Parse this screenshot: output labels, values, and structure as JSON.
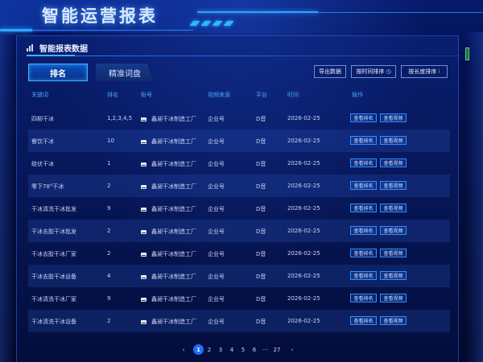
{
  "page_title": "智能运营报表",
  "panel": {
    "title": "智能报表数据"
  },
  "tabs": [
    {
      "label": "排名",
      "active": true
    },
    {
      "label": "精准词盘",
      "active": false
    }
  ],
  "toolbar": {
    "export_label": "导出数据",
    "sort_time_label": "按时间排序",
    "sort_length_label": "按长度排序"
  },
  "table": {
    "columns": [
      "关键词",
      "排名",
      "账号",
      "视频来源",
      "平台",
      "时间",
      "操作"
    ],
    "rows": [
      {
        "keyword": "四柳干冰",
        "rank": "1,2,3,4,5",
        "account": "鑫昶干冰制造工厂",
        "source": "企业号",
        "platform": "D音",
        "time": "2026-02-25"
      },
      {
        "keyword": "餐饮干冰",
        "rank": "10",
        "account": "鑫昶干冰制造工厂",
        "source": "企业号",
        "platform": "D音",
        "time": "2026-02-25"
      },
      {
        "keyword": "硅伏干冰",
        "rank": "1",
        "account": "鑫昶干冰制造工厂",
        "source": "企业号",
        "platform": "D音",
        "time": "2026-02-25"
      },
      {
        "keyword": "零下78°干冰",
        "rank": "2",
        "account": "鑫昶干冰制造工厂",
        "source": "企业号",
        "platform": "D音",
        "time": "2026-02-25"
      },
      {
        "keyword": "干冰清洗干冰批发",
        "rank": "9",
        "account": "鑫昶干冰制造工厂",
        "source": "企业号",
        "platform": "D音",
        "time": "2026-02-25"
      },
      {
        "keyword": "干冰去胶干冰批发",
        "rank": "2",
        "account": "鑫昶干冰制造工厂",
        "source": "企业号",
        "platform": "D音",
        "time": "2026-02-25"
      },
      {
        "keyword": "干冰去胶干冰厂家",
        "rank": "2",
        "account": "鑫昶干冰制造工厂",
        "source": "企业号",
        "platform": "D音",
        "time": "2026-02-25"
      },
      {
        "keyword": "干冰去胶干冰设备",
        "rank": "4",
        "account": "鑫昶干冰制造工厂",
        "source": "企业号",
        "platform": "D音",
        "time": "2026-02-25"
      },
      {
        "keyword": "干冰清洗干冰厂家",
        "rank": "9",
        "account": "鑫昶干冰制造工厂",
        "source": "企业号",
        "platform": "D音",
        "time": "2026-02-25"
      },
      {
        "keyword": "干冰清洗干冰设备",
        "rank": "2",
        "account": "鑫昶干冰制造工厂",
        "source": "企业号",
        "platform": "D音",
        "time": "2026-02-25"
      }
    ],
    "action_view_rank": "查看排名",
    "action_view_video": "查看视频"
  },
  "pagination": {
    "prev": "‹",
    "pages": [
      "1",
      "2",
      "3",
      "4",
      "5",
      "6"
    ],
    "ellipsis": "···",
    "last": "27",
    "next": "›",
    "current": "1"
  },
  "colors": {
    "background": "#030d3a",
    "accent": "#39b4ff",
    "header_text": "#4fa3ff",
    "active_page": "#1f6dff"
  }
}
